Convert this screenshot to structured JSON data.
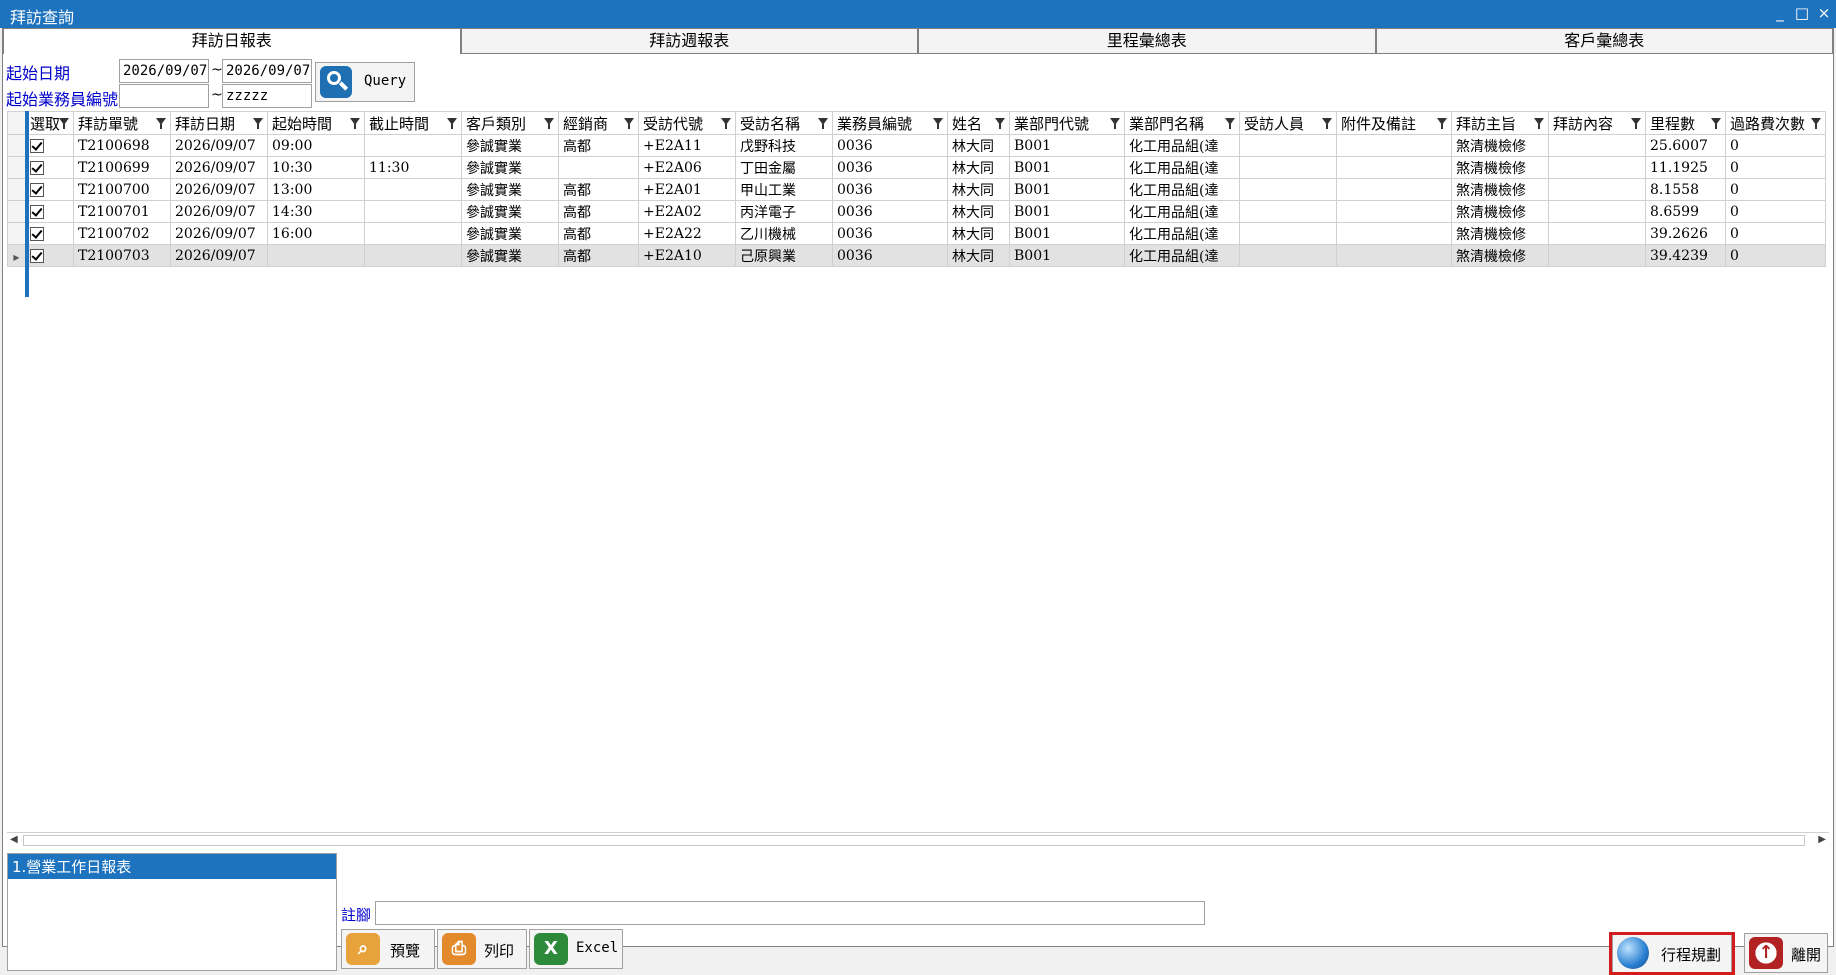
{
  "window": {
    "title": "拜訪查詢",
    "controls": [
      "_",
      "□",
      "×"
    ]
  },
  "tabs": [
    {
      "label": "拜訪日報表",
      "active": true
    },
    {
      "label": "拜訪週報表",
      "active": false
    },
    {
      "label": "里程彙總表",
      "active": false
    },
    {
      "label": "客戶彙總表",
      "active": false
    }
  ],
  "filters": {
    "date_label": "起始日期",
    "date_from": "2026/09/07",
    "date_to": "2026/09/07",
    "tilde": "~",
    "salesperson_label": "起始業務員編號",
    "salesperson_from": "",
    "salesperson_to": "zzzzz",
    "query_label": "Query"
  },
  "grid": {
    "columns": [
      "選取",
      "拜訪單號",
      "拜訪日期",
      "起始時間",
      "截止時間",
      "客戶類別",
      "經銷商",
      "受訪代號",
      "受訪名稱",
      "業務員編號",
      "姓名",
      "業部門代號",
      "業部門名稱",
      "受訪人員",
      "附件及備註",
      "拜訪主旨",
      "拜訪內容",
      "里程數",
      "過路費次數"
    ],
    "rows": [
      {
        "id": "T2100698",
        "date": "2026/09/07",
        "start": "09:00",
        "end": "",
        "type": "參誠實業",
        "dealer": "高都",
        "code": "+E2A11",
        "name": "戊野科技",
        "sales_no": "0036",
        "person": "林大同",
        "dept_code": "B001",
        "dept_name": "化工用品組(達",
        "visitor": "",
        "note": "",
        "subject": "煞清機檢修",
        "content": "",
        "mileage": "25.6007",
        "toll": "0"
      },
      {
        "id": "T2100699",
        "date": "2026/09/07",
        "start": "10:30",
        "end": "11:30",
        "type": "參誠實業",
        "dealer": "",
        "code": "+E2A06",
        "name": "丁田金屬",
        "sales_no": "0036",
        "person": "林大同",
        "dept_code": "B001",
        "dept_name": "化工用品組(達",
        "visitor": "",
        "note": "",
        "subject": "煞清機檢修",
        "content": "",
        "mileage": "11.1925",
        "toll": "0"
      },
      {
        "id": "T2100700",
        "date": "2026/09/07",
        "start": "13:00",
        "end": "",
        "type": "參誠實業",
        "dealer": "高都",
        "code": "+E2A01",
        "name": "甲山工業",
        "sales_no": "0036",
        "person": "林大同",
        "dept_code": "B001",
        "dept_name": "化工用品組(達",
        "visitor": "",
        "note": "",
        "subject": "煞清機檢修",
        "content": "",
        "mileage": "8.1558",
        "toll": "0"
      },
      {
        "id": "T2100701",
        "date": "2026/09/07",
        "start": "14:30",
        "end": "",
        "type": "參誠實業",
        "dealer": "高都",
        "code": "+E2A02",
        "name": "丙洋電子",
        "sales_no": "0036",
        "person": "林大同",
        "dept_code": "B001",
        "dept_name": "化工用品組(達",
        "visitor": "",
        "note": "",
        "subject": "煞清機檢修",
        "content": "",
        "mileage": "8.6599",
        "toll": "0"
      },
      {
        "id": "T2100702",
        "date": "2026/09/07",
        "start": "16:00",
        "end": "",
        "type": "參誠實業",
        "dealer": "高都",
        "code": "+E2A22",
        "name": "乙川機械",
        "sales_no": "0036",
        "person": "林大同",
        "dept_code": "B001",
        "dept_name": "化工用品組(達",
        "visitor": "",
        "note": "",
        "subject": "煞清機檢修",
        "content": "",
        "mileage": "39.2626",
        "toll": "0"
      },
      {
        "id": "T2100703",
        "date": "2026/09/07",
        "start": "",
        "end": "",
        "type": "參誠實業",
        "dealer": "高都",
        "code": "+E2A10",
        "name": "己原興業",
        "sales_no": "0036",
        "person": "林大同",
        "dept_code": "B001",
        "dept_name": "化工用品組(達",
        "visitor": "",
        "note": "",
        "subject": "煞清機檢修",
        "content": "",
        "mileage": "39.4239",
        "toll": "0"
      }
    ]
  },
  "reports": {
    "items": [
      "1.營業工作日報表"
    ]
  },
  "footer": {
    "note_label": "註腳",
    "note_value": "",
    "preview_label": "預覽",
    "print_label": "列印",
    "excel_label": "Excel",
    "route_label": "行程規劃",
    "exit_label": "離開"
  },
  "colors": {
    "titlebar": "#1e73be",
    "label_blue": "#0000cc",
    "highlight_red": "#d41c1c"
  }
}
